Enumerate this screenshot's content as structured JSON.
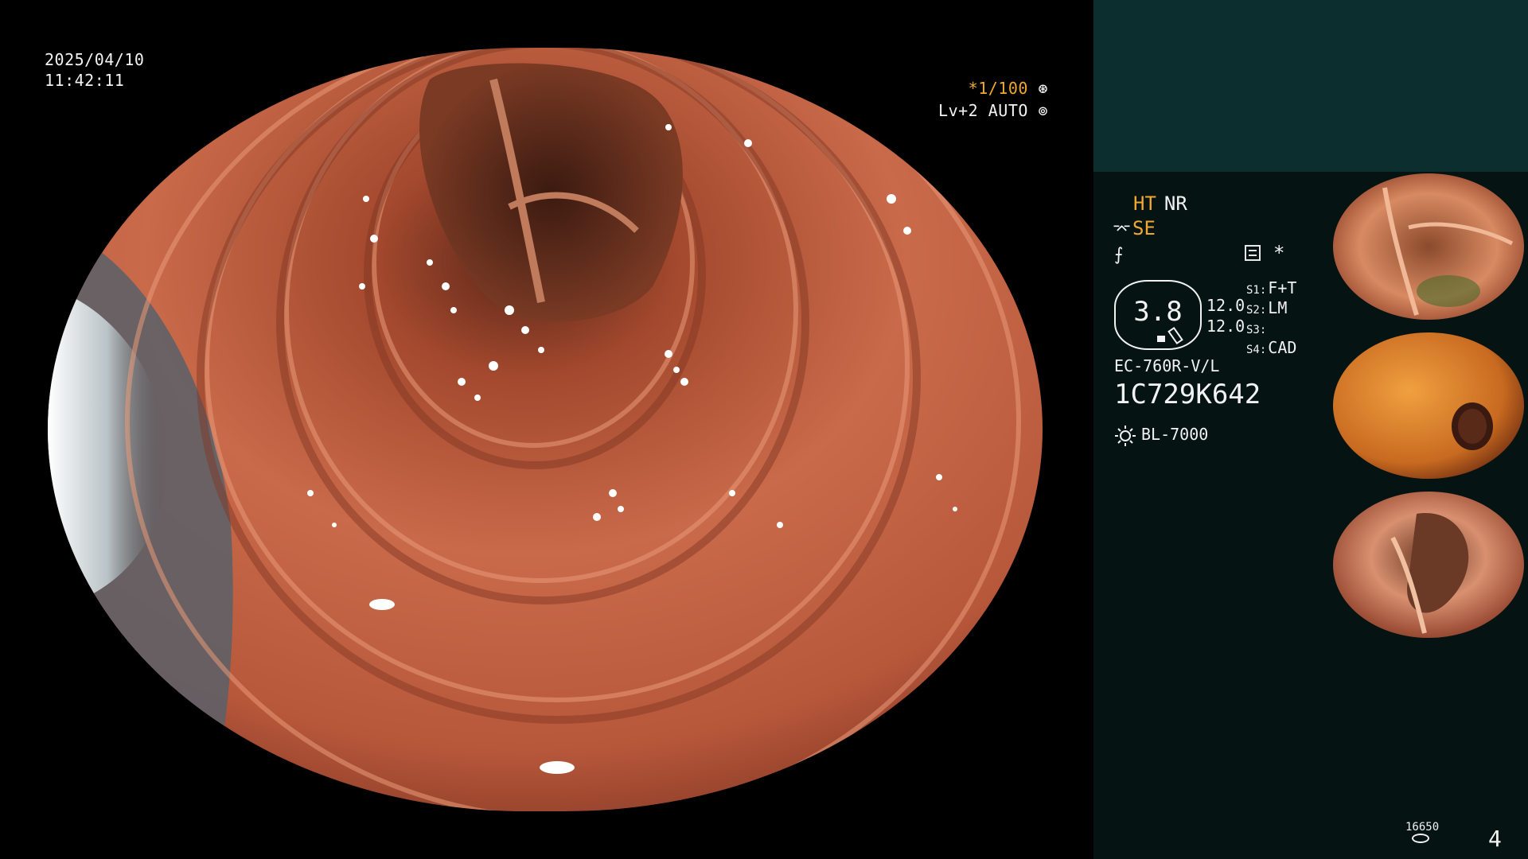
{
  "osd": {
    "date": "2025/04/10",
    "time": "11:42:11",
    "shutter_mark": "*1/100",
    "shutter_icon": "aperture-icon",
    "iris": "Lv+2 AUTO",
    "iris_icon": "iris-icon"
  },
  "panel": {
    "mode_ht": "HT",
    "mode_nr": "NR",
    "se_label": "SE",
    "se_icon": "structure-enhance-icon",
    "struct_icon": "edge-enhance-icon",
    "list_icon": "memory-list-icon",
    "star": "*",
    "zoom_value": "3.8",
    "value_1": "12.0",
    "value_2": "12.0",
    "switches": [
      {
        "key": "S1:",
        "value": "F+T"
      },
      {
        "key": "S2:",
        "value": "LM"
      },
      {
        "key": "S3:",
        "value": ""
      },
      {
        "key": "S4:",
        "value": "CAD"
      }
    ],
    "scope_model": "EC-760R-V/L",
    "scope_serial": "1C729K642",
    "light_icon": "light-source-icon",
    "light_source": "BL-7000",
    "counter": "16650",
    "page": "4"
  },
  "colors": {
    "accent_orange": "#f0a830",
    "panel_top": "#0d2e2e",
    "panel_bg": "#051413",
    "text": "#f2f2f2"
  }
}
